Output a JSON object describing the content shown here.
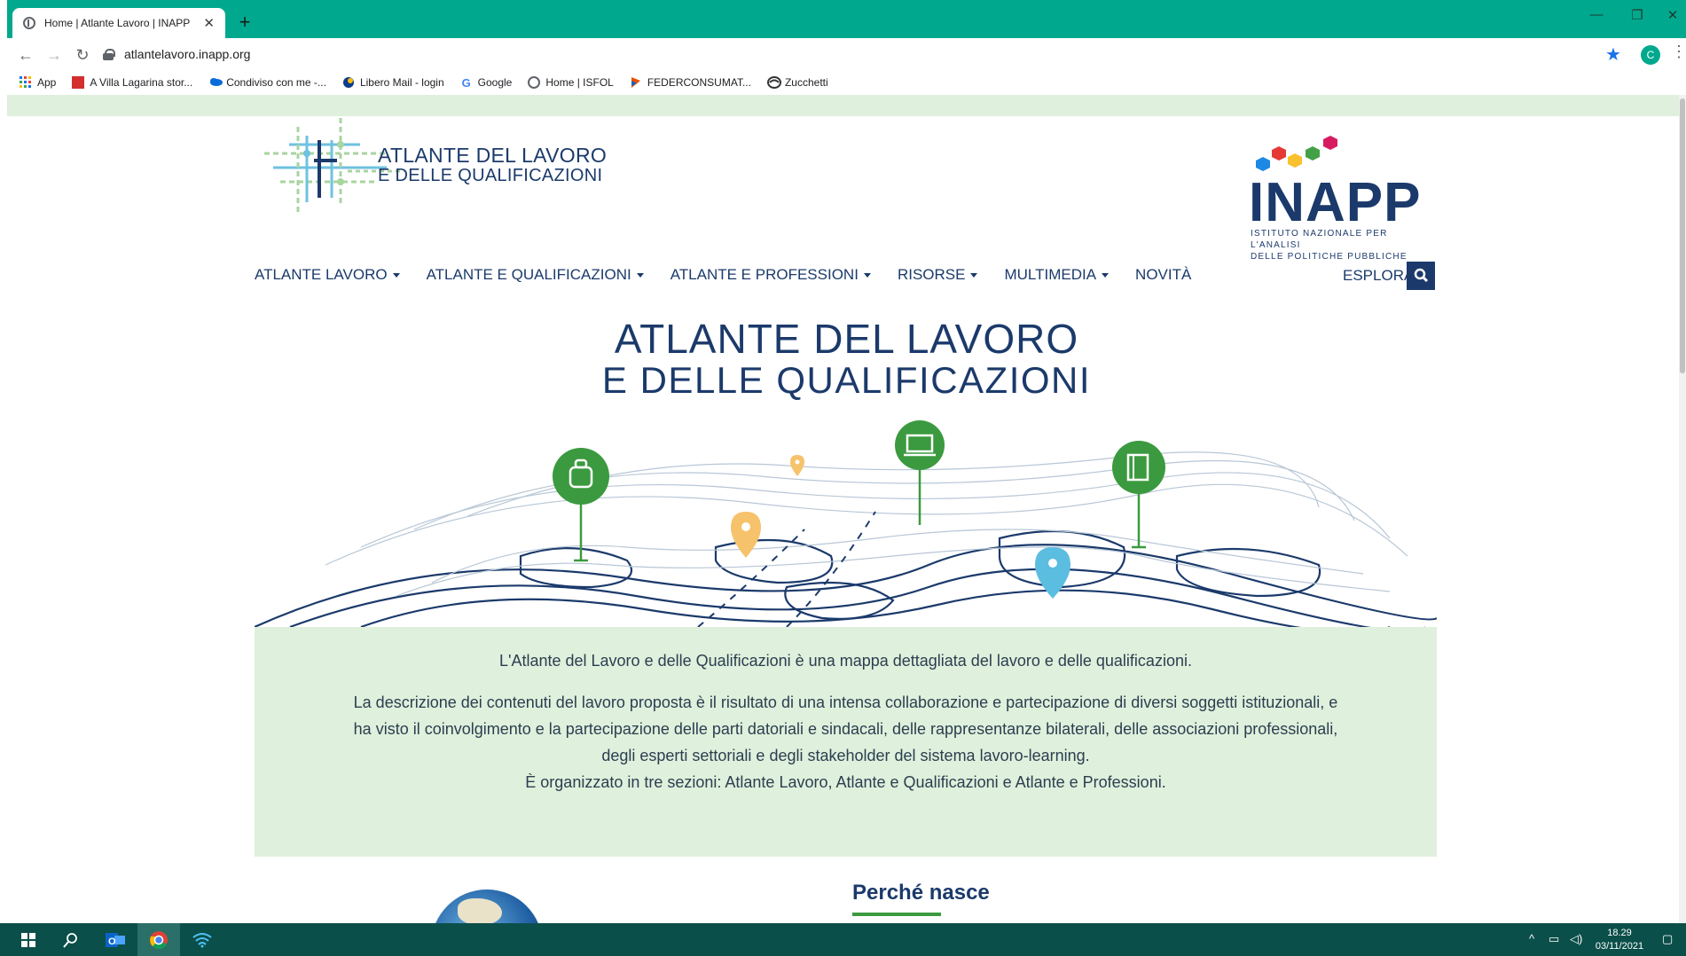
{
  "browser": {
    "tab_title": "Home | Atlante Lavoro | INAPP",
    "tab_close": "✕",
    "new_tab": "+",
    "url": "atlantelavoro.inapp.org",
    "profile_initial": "C",
    "bookmarks": [
      {
        "label": "App",
        "icon": "apps-grid-icon"
      },
      {
        "label": "A Villa Lagarina stor...",
        "icon": "rai-icon"
      },
      {
        "label": "Condiviso con me -...",
        "icon": "onedrive-cloud-icon"
      },
      {
        "label": "Libero Mail - login",
        "icon": "libero-icon"
      },
      {
        "label": "Google",
        "icon": "google-icon"
      },
      {
        "label": "Home | ISFOL",
        "icon": "globe-icon"
      },
      {
        "label": "FEDERCONSUMAT...",
        "icon": "federconsumatori-icon"
      },
      {
        "label": "Zucchetti",
        "icon": "zucchetti-icon"
      }
    ]
  },
  "site": {
    "logo_line1": "ATLANTE DEL LAVORO",
    "logo_line2": "E DELLE QUALIFICAZIONI",
    "inapp_word": "INAPP",
    "inapp_sub1": "ISTITUTO NAZIONALE PER L'ANALISI",
    "inapp_sub2": "DELLE POLITICHE PUBBLICHE",
    "nav": [
      {
        "label": "ATLANTE LAVORO",
        "dropdown": true
      },
      {
        "label": "ATLANTE E QUALIFICAZIONI",
        "dropdown": true
      },
      {
        "label": "ATLANTE E PROFESSIONI",
        "dropdown": true
      },
      {
        "label": "RISORSE",
        "dropdown": true
      },
      {
        "label": "MULTIMEDIA",
        "dropdown": true
      },
      {
        "label": "NOVITÀ",
        "dropdown": false
      }
    ],
    "esplora": "ESPLORA",
    "hero_title1": "ATLANTE DEL LAVORO",
    "hero_title2": "E DELLE QUALIFICAZIONI",
    "intro_p1": "L'Atlante del Lavoro e delle Qualificazioni è una mappa dettagliata del lavoro e delle qualificazioni.",
    "intro_p2": "La descrizione dei contenuti del lavoro proposta è il risultato di una intensa collaborazione e partecipazione di diversi soggetti istituzionali, e ha visto il coinvolgimento e la partecipazione delle parti datoriali e sindacali, delle rappresentanze bilaterali, delle associazioni professionali, degli esperti settoriali e degli stakeholder del sistema lavoro-learning.",
    "intro_p3": "È organizzato in tre sezioni: Atlante Lavoro, Atlante e Qualificazioni e Atlante e Professioni.",
    "section_heading": "Perché nasce",
    "colors": {
      "navy": "#1b3a6b",
      "green": "#3b9a3f",
      "mint": "#dff0dc",
      "chrome_teal": "#00a98d"
    }
  },
  "taskbar": {
    "time": "18.29",
    "date": "03/11/2021"
  }
}
